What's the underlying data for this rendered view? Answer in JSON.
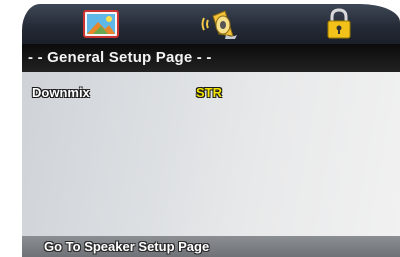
{
  "tabs": [
    {
      "icon": "general-setup-icon",
      "selected": true
    },
    {
      "icon": "speaker-setup-icon",
      "selected": false
    },
    {
      "icon": "preferences-lock-icon",
      "selected": false
    }
  ],
  "page_title": "- - General Setup Page - -",
  "options": [
    {
      "label": "Downmix",
      "value": "STR"
    }
  ],
  "status": "Go To Speaker Setup Page",
  "colors": {
    "value_text": "#f2e400",
    "tabbar": "#262c37",
    "titlebar": "#111111",
    "statusbar": "#7c7f83"
  }
}
